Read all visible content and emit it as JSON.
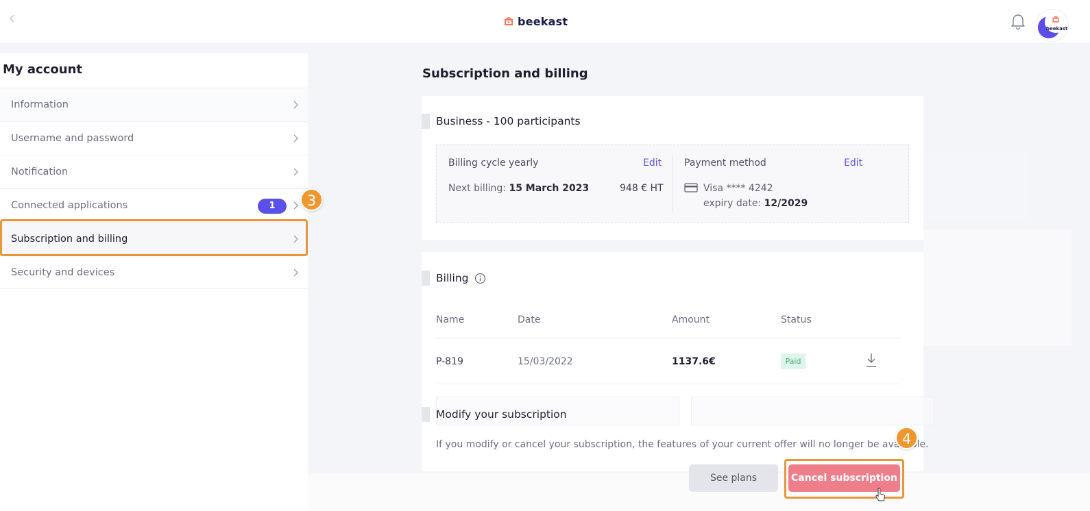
{
  "header": {
    "back_icon": "chevron-left-icon",
    "brand_name": "beekast",
    "bell_icon": "bell-icon",
    "avatar_text": "beekast"
  },
  "sidebar": {
    "title": "My account",
    "items": [
      {
        "label": "Information"
      },
      {
        "label": "Username and password"
      },
      {
        "label": "Notification"
      },
      {
        "label": "Connected applications",
        "badge": "1"
      },
      {
        "label": "Subscription and billing",
        "active": true
      },
      {
        "label": "Security and devices"
      }
    ]
  },
  "markers": {
    "step3": "3",
    "step4": "4"
  },
  "main": {
    "title": "Subscription and billing",
    "plan": {
      "title": "Business - 100 participants",
      "billing_cycle_label": "Billing cycle yearly",
      "billing_edit": "Edit",
      "next_billing_label": "Next billing:",
      "next_billing_date": "15 March 2023",
      "price": "948 € HT",
      "payment_label": "Payment method",
      "payment_edit": "Edit",
      "card": "Visa **** 4242",
      "expiry_label": "expiry date:",
      "expiry_value": "12/2029"
    },
    "billing": {
      "title": "Billing",
      "columns": [
        "Name",
        "Date",
        "Amount",
        "Status"
      ],
      "rows": [
        {
          "name": "P-819",
          "date": "15/03/2022",
          "amount": "1137.6€",
          "status": "Paid"
        }
      ]
    },
    "modify": {
      "title": "Modify your subscription",
      "text": "If you modify or cancel your subscription, the features of your current offer will no longer be available."
    },
    "buttons": {
      "see_plans": "See plans",
      "cancel": "Cancel subscription"
    }
  },
  "colors": {
    "accent": "#5b51e8",
    "cancel": "#ee7e8a",
    "highlight": "#e8963a",
    "paid_bg": "#dff4ea",
    "paid_text": "#42a878"
  }
}
